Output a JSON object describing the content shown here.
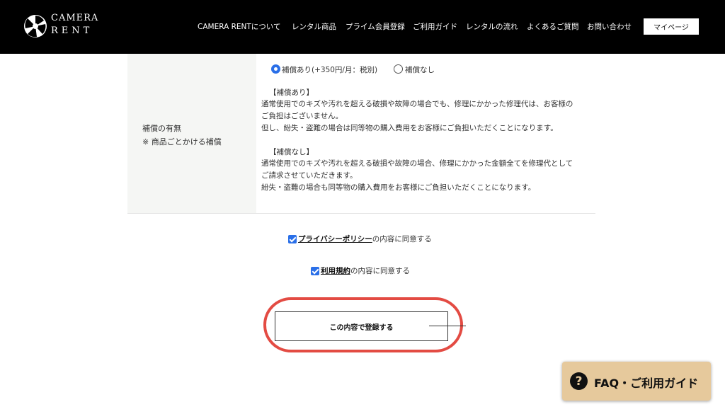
{
  "header": {
    "logo": {
      "line1": "CAMERA",
      "line2": "RENT"
    },
    "nav": [
      {
        "label": "CAMERA RENTについて"
      },
      {
        "label": "レンタル商品"
      },
      {
        "label": "プライム会員登録"
      },
      {
        "label": "ご利用ガイド"
      },
      {
        "label": "レンタルの流れ"
      },
      {
        "label": "よくあるご質問"
      },
      {
        "label": "お問い合わせ"
      }
    ],
    "mypage_label": "マイページ"
  },
  "compensation": {
    "label_line1": "補償の有無",
    "label_line2": "※ 商品ごとかける補償",
    "options": [
      {
        "label": "補償あり(+350円/月：税別)",
        "selected": true
      },
      {
        "label": "補償なし",
        "selected": false
      }
    ],
    "with": {
      "heading": "【補償あり】",
      "lines": [
        "通常使用でのキズや汚れを超える破損や故障の場合でも、修理にかかった修理代は、お客様の",
        "ご負担はございません。",
        "但し、紛失・盗難の場合は同等物の購入費用をお客様にご負担いただくことになります。"
      ]
    },
    "without": {
      "heading": "【補償なし】",
      "lines": [
        "通常使用でのキズや汚れを超える破損や故障の場合、修理にかかった金額全てを修理代として",
        "ご請求させていただきます。",
        "紛失・盗難の場合も同等物の購入費用をお客様にご負担いただくことになります。"
      ]
    }
  },
  "agreements": {
    "privacy": {
      "link": "プライバシーポリシー",
      "suffix": "の内容に同意する",
      "checked": true
    },
    "terms": {
      "link": "利用規約",
      "suffix": "の内容に同意する",
      "checked": true
    }
  },
  "submit": {
    "label": "この内容で登録する"
  },
  "faq": {
    "icon": "?",
    "label": "FAQ・ご利用ガイド"
  },
  "colors": {
    "header_bg": "#000000",
    "accent": "#2a6fe8",
    "highlight": "#e34b43",
    "faq_bg": "#e6c99c"
  }
}
